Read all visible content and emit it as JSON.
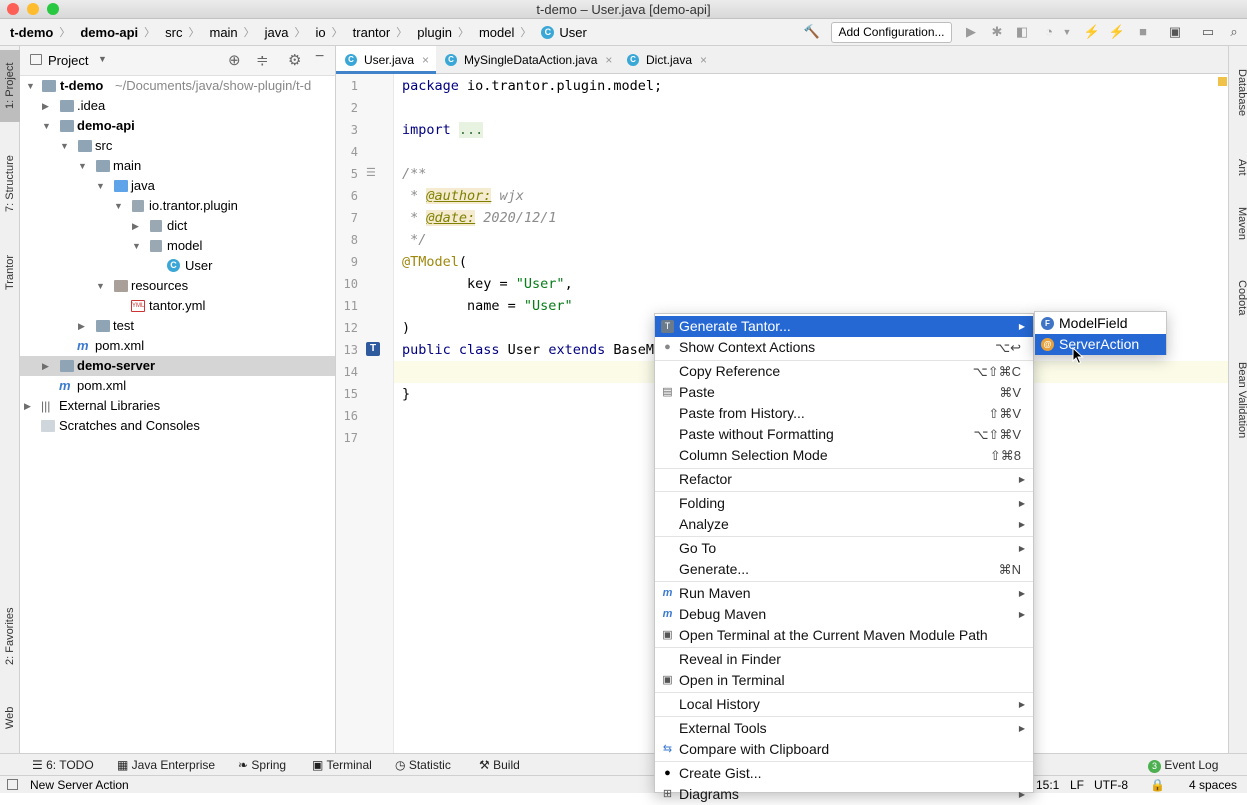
{
  "window": {
    "title": "t-demo – User.java [demo-api]"
  },
  "breadcrumbs": [
    "t-demo",
    "demo-api",
    "src",
    "main",
    "java",
    "io",
    "trantor",
    "plugin",
    "model",
    "User"
  ],
  "toolbar": {
    "add_config_label": "Add Configuration..."
  },
  "left_stripe": {
    "project": "1: Project",
    "structure": "7: Structure",
    "trantor": "Trantor",
    "favorites": "2: Favorites",
    "web": "Web"
  },
  "project_panel": {
    "title": "Project",
    "tree": [
      {
        "label": "t-demo",
        "hint": "~/Documents/java/show-plugin/t-d",
        "bold": true
      },
      {
        "label": ".idea"
      },
      {
        "label": "demo-api",
        "bold": true
      },
      {
        "label": "src"
      },
      {
        "label": "main"
      },
      {
        "label": "java"
      },
      {
        "label": "io.trantor.plugin"
      },
      {
        "label": "dict"
      },
      {
        "label": "model"
      },
      {
        "label": "User"
      },
      {
        "label": "resources"
      },
      {
        "label": "tantor.yml"
      },
      {
        "label": "test"
      },
      {
        "label": "pom.xml"
      },
      {
        "label": "demo-server",
        "bold": true
      },
      {
        "label": "pom.xml"
      },
      {
        "label": "External Libraries"
      },
      {
        "label": "Scratches and Consoles"
      }
    ]
  },
  "editor": {
    "tabs": [
      "User.java",
      "MySingleDataAction.java",
      "Dict.java"
    ],
    "line_numbers": [
      "1",
      "2",
      "3",
      "4",
      "5",
      "6",
      "7",
      "8",
      "9",
      "10",
      "11",
      "12",
      "13",
      "14",
      "15",
      "16",
      "17"
    ],
    "code": {
      "l1_kw": "package",
      "l1_rest": " io.trantor.plugin.model;",
      "l3_kw": "import",
      "l3_rest": "...",
      "l6": "/**",
      "l7_pre": " * ",
      "l7_tag": "@author:",
      "l7_val": " wjx",
      "l8_pre": " * ",
      "l8_tag": "@date:",
      "l8_val": " 2020/12/1",
      "l9": " */",
      "l10_ann": "@TModel",
      "l10_rest": "(",
      "l11_pre": "        key = ",
      "l11_str": "\"User\"",
      "l11_post": ",",
      "l12_pre": "        name = ",
      "l12_str": "\"User\"",
      "l13": ")",
      "l14_kw": "public class",
      "l14_mid": " User ",
      "l14_kw2": "extends",
      "l14_rest": " BaseMo",
      "l16": "}"
    }
  },
  "right_stripe": {
    "database": "Database",
    "ant": "Ant",
    "maven": "Maven",
    "codota": "Codota",
    "bean": "Bean Validation"
  },
  "context_menu": {
    "items": [
      {
        "label": "Generate Tantor...",
        "shortcut": "",
        "submenu": true,
        "highlighted": true
      },
      {
        "label": "Show Context Actions",
        "shortcut": "⌥↩"
      },
      {
        "label": "Copy Reference",
        "shortcut": "⌥⇧⌘C"
      },
      {
        "label": "Paste",
        "shortcut": "⌘V"
      },
      {
        "label": "Paste from History...",
        "shortcut": "⇧⌘V"
      },
      {
        "label": "Paste without Formatting",
        "shortcut": "⌥⇧⌘V"
      },
      {
        "label": "Column Selection Mode",
        "shortcut": "⇧⌘8"
      },
      {
        "label": "Refactor",
        "submenu": true
      },
      {
        "label": "Folding",
        "submenu": true
      },
      {
        "label": "Analyze",
        "submenu": true
      },
      {
        "label": "Go To",
        "submenu": true
      },
      {
        "label": "Generate...",
        "shortcut": "⌘N"
      },
      {
        "label": "Run Maven",
        "submenu": true
      },
      {
        "label": "Debug Maven",
        "submenu": true
      },
      {
        "label": "Open Terminal at the Current Maven Module Path"
      },
      {
        "label": "Reveal in Finder"
      },
      {
        "label": "Open in Terminal"
      },
      {
        "label": "Local History",
        "submenu": true
      },
      {
        "label": "External Tools",
        "submenu": true
      },
      {
        "label": "Compare with Clipboard"
      },
      {
        "label": "Create Gist..."
      },
      {
        "label": "Diagrams",
        "submenu": true
      }
    ]
  },
  "submenu": {
    "items": [
      {
        "label": "ModelField",
        "icon_letter": "F"
      },
      {
        "label": "ServerAction",
        "icon_letter": "@",
        "highlighted": true
      }
    ]
  },
  "bottom_tools": [
    "6: TODO",
    "Java Enterprise",
    "Spring",
    "Terminal",
    "Statistic",
    "Build",
    "Event Log"
  ],
  "event_log_count": "3",
  "status": {
    "message": "New Server Action",
    "position": "15:1",
    "line_sep": "LF",
    "encoding": "UTF-8",
    "indent": "4 spaces"
  }
}
